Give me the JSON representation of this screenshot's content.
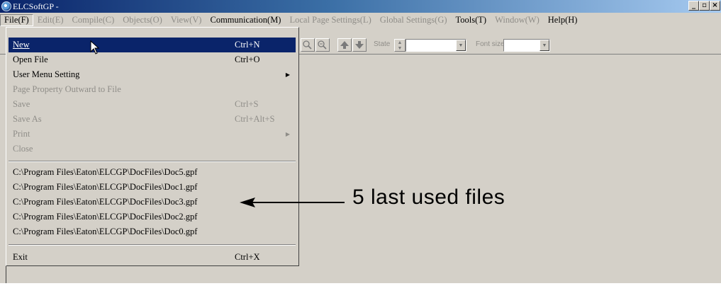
{
  "window": {
    "title": "ELCSoftGP -",
    "controls": [
      "_",
      "▫",
      "×"
    ]
  },
  "menubar": {
    "items": [
      {
        "label": "File(F)",
        "state": "open"
      },
      {
        "label": "Edit(E)",
        "state": "disabled"
      },
      {
        "label": "Compile(C)",
        "state": "disabled"
      },
      {
        "label": "Objects(O)",
        "state": "disabled"
      },
      {
        "label": "View(V)",
        "state": "disabled"
      },
      {
        "label": "Communication(M)",
        "state": "enabled"
      },
      {
        "label": "Local Page Settings(L)",
        "state": "disabled"
      },
      {
        "label": "Global Settings(G)",
        "state": "disabled"
      },
      {
        "label": "Tools(T)",
        "state": "enabled"
      },
      {
        "label": "Window(W)",
        "state": "disabled"
      },
      {
        "label": "Help(H)",
        "state": "enabled"
      }
    ]
  },
  "toolbar": {
    "state_label": "State",
    "font_size_label": "Font size",
    "state_value": "",
    "font_size_value": ""
  },
  "file_menu": {
    "items": [
      {
        "label": "New",
        "shortcut": "Ctrl+N"
      },
      {
        "label": "Open File",
        "shortcut": "Ctrl+O"
      },
      {
        "label": "User Menu Setting",
        "shortcut": ""
      },
      {
        "label": "Page Property Outward to File",
        "shortcut": ""
      },
      {
        "label": "Save",
        "shortcut": "Ctrl+S"
      },
      {
        "label": "Save As",
        "shortcut": "Ctrl+Alt+S"
      },
      {
        "label": "Print",
        "shortcut": ""
      },
      {
        "label": "Close",
        "shortcut": ""
      }
    ],
    "recent_files": [
      "C:\\Program Files\\Eaton\\ELCGP\\DocFiles\\Doc5.gpf",
      "C:\\Program Files\\Eaton\\ELCGP\\DocFiles\\Doc1.gpf",
      "C:\\Program Files\\Eaton\\ELCGP\\DocFiles\\Doc3.gpf",
      "C:\\Program Files\\Eaton\\ELCGP\\DocFiles\\Doc2.gpf",
      "C:\\Program Files\\Eaton\\ELCGP\\DocFiles\\Doc0.gpf"
    ],
    "exit": {
      "label": "Exit",
      "shortcut": "Ctrl+X"
    }
  },
  "annotation": {
    "text": "5 last used files"
  },
  "colors": {
    "title_start": "#0a246a",
    "title_end": "#a6caf0",
    "selection": "#0a246a",
    "face": "#d4d0c8",
    "disabled_text": "#8f8d88"
  }
}
